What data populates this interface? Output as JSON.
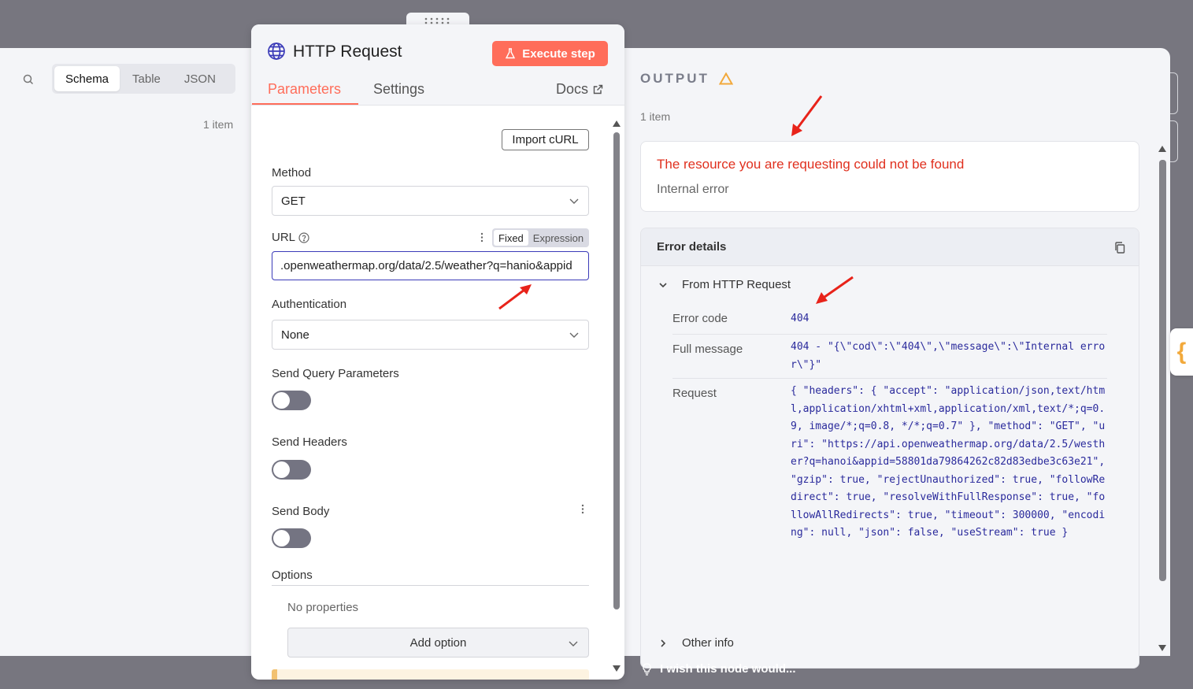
{
  "input": {
    "tabs": [
      "Schema",
      "Table",
      "JSON"
    ],
    "item_count": "1 item"
  },
  "node": {
    "title": "HTTP Request",
    "execute_label": "Execute step",
    "tabs": {
      "parameters": "Parameters",
      "settings": "Settings"
    },
    "docs_label": "Docs",
    "import_curl_label": "Import cURL",
    "method": {
      "label": "Method",
      "value": "GET"
    },
    "url": {
      "label": "URL",
      "mode_fixed": "Fixed",
      "mode_expression": "Expression",
      "value": ".openweathermap.org/data/2.5/weather?q=hanio&appid"
    },
    "authentication": {
      "label": "Authentication",
      "value": "None"
    },
    "send_query_label": "Send Query Parameters",
    "send_headers_label": "Send Headers",
    "send_body_label": "Send Body",
    "options_label": "Options",
    "no_properties": "No properties",
    "add_option_label": "Add option"
  },
  "output": {
    "title": "OUTPUT",
    "item_count": "1 item",
    "error_title": "The resource you are requesting could not be found",
    "error_subtitle": "Internal error",
    "details_title": "Error details",
    "from_label": "From HTTP Request",
    "error_code_label": "Error code",
    "error_code": "404",
    "full_message_label": "Full message",
    "full_message": "404 - \"{\\\"cod\\\":\\\"404\\\",\\\"message\\\":\\\"Internal error\\\"}\"",
    "request_label": "Request",
    "request": "{ \"headers\": { \"accept\": \"application/json,text/html,application/xhtml+xml,application/xml,text/*;q=0.9, image/*;q=0.8, */*;q=0.7\" }, \"method\": \"GET\", \"uri\": \"https://api.openweathermap.org/data/2.5/westher?q=hanoi&appid=58801da79864262c82d83edbe3c63e21\", \"gzip\": true, \"rejectUnauthorized\": true, \"followRedirect\": true, \"resolveWithFullResponse\": true, \"followAllRedirects\": true, \"timeout\": 300000, \"encoding\": null, \"json\": false, \"useStream\": true }",
    "other_info_label": "Other info"
  },
  "footer": {
    "wish_text": "I wish this node would..."
  },
  "colors": {
    "accent": "#ff6d5a",
    "error": "#e0301e",
    "mono_value": "#2a2a9c",
    "warning": "#f2a93b"
  }
}
